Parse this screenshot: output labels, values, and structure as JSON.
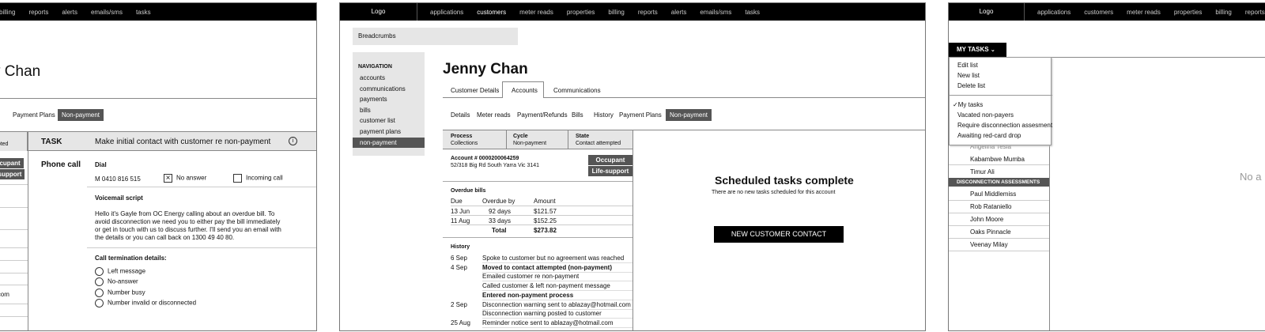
{
  "nav_items": [
    "applications",
    "customers",
    "meter reads",
    "properties",
    "billing",
    "reports",
    "alerts",
    "emails/sms",
    "tasks"
  ],
  "logo": "Logo",
  "customer_name": "Jenny Chan",
  "panel1": {
    "nav_tail": [
      "billing",
      "reports",
      "alerts",
      "emails/sms",
      "tasks"
    ],
    "name_tail": "y Chan",
    "subtabs": [
      "ry",
      "Payment Plans",
      "Non-payment"
    ],
    "state_tail": "mpted",
    "badges": [
      "ccupant",
      "-support"
    ],
    "task_label": "TASK",
    "task_title": "Make initial contact with customer re non-payment",
    "info_icon": "info-icon",
    "phone_call": "Phone call",
    "dial_label": "Dial",
    "dial_number": "M 0410 816 515",
    "no_answer": "No answer",
    "incoming_call": "Incoming call",
    "voicemail_label": "Voicemail script",
    "voicemail_text": [
      "Hello it's Gayle from OC Energy calling about an overdue bill. To",
      "avoid disconnection we need you to either pay the bill immediately",
      "or get in touch with us to discuss further. I'll send you an email with",
      "the details or you can call back on 1300 49 40 80."
    ],
    "termination_label": "Call termination details:",
    "options": [
      "Left message",
      "No-answer",
      "Number busy",
      "Number invalid or disconnected"
    ],
    "email_tail": "il.com"
  },
  "panel2": {
    "breadcrumbs": "Breadcrumbs",
    "nav_header": "NAVIGATION",
    "nav_links": [
      "accounts",
      "communications",
      "payments",
      "bills",
      "customer list",
      "payment plans",
      "non-payment"
    ],
    "tabs": [
      "Customer Details",
      "Accounts",
      "Communications"
    ],
    "subtabs": [
      "Details",
      "Meter reads",
      "Payment/Refunds",
      "Bills",
      "History",
      "Payment Plans",
      "Non-payment"
    ],
    "process_label": "Process",
    "process_value": "Collections",
    "cycle_label": "Cycle",
    "cycle_value": "Non-payment",
    "state_label": "State",
    "state_value": "Contact attempted",
    "account": "Account # 0000200064259",
    "address": "52/318 Big Rd South Yarra Vic 3141",
    "badge_occupant": "Occupant",
    "badge_life": "Life-support",
    "overdue_label": "Overdue bills",
    "overdue_headers": [
      "Due",
      "Overdue by",
      "Amount"
    ],
    "overdue_rows": [
      [
        "13 Jun",
        "92 days",
        "$121.57"
      ],
      [
        "11 Aug",
        "33 days",
        "$152.25"
      ]
    ],
    "total_label": "Total",
    "total_value": "$273.82",
    "history_label": "History",
    "history": [
      {
        "date": "6 Sep",
        "text": "Spoke to customer but no agreement was reached",
        "bold": false
      },
      {
        "date": "4 Sep",
        "text": "Moved to contact attempted (non-payment)",
        "bold": true
      },
      {
        "date": "",
        "text": "Emailed customer re non-payment",
        "bold": false
      },
      {
        "date": "",
        "text": "Called customer & left non-payment message",
        "bold": false
      },
      {
        "date": "",
        "text": "Entered non-payment process",
        "bold": true
      },
      {
        "date": "2 Sep",
        "text": "Disconnection warning sent to ablazay@hotmail.com",
        "bold": false
      },
      {
        "date": "",
        "text": "Disconnection warning posted to customer",
        "bold": false
      },
      {
        "date": "25 Aug",
        "text": "Reminder notice sent to ablazay@hotmail.com",
        "bold": false
      }
    ],
    "scheduled_title": "Scheduled tasks complete",
    "scheduled_sub": "There are no new tasks scheduled for this account",
    "new_contact": "NEW CUSTOMER CONTACT"
  },
  "panel3": {
    "nav_items": [
      "applications",
      "customers",
      "meter reads",
      "properties",
      "billing",
      "reports"
    ],
    "my_tasks": "MY TASKS",
    "menu_actions": [
      "Edit list",
      "New list",
      "Delete list"
    ],
    "menu_lists": [
      "My tasks",
      "Vacated non-payers",
      "Require disconnection assesment",
      "Awaiting red-card drop"
    ],
    "check": "✓",
    "partial_name": "Angelina Tesla",
    "names_a": [
      "Kabambwe Mumba",
      "Timur Ali"
    ],
    "section": "DISCONNECTION ASSESSMENTS",
    "names_b": [
      "Paul Middlemiss",
      "Rob Rataniello",
      "John Moore",
      "Oaks Pinnacle",
      "Veenay Milay"
    ],
    "no_tail": "No a"
  }
}
